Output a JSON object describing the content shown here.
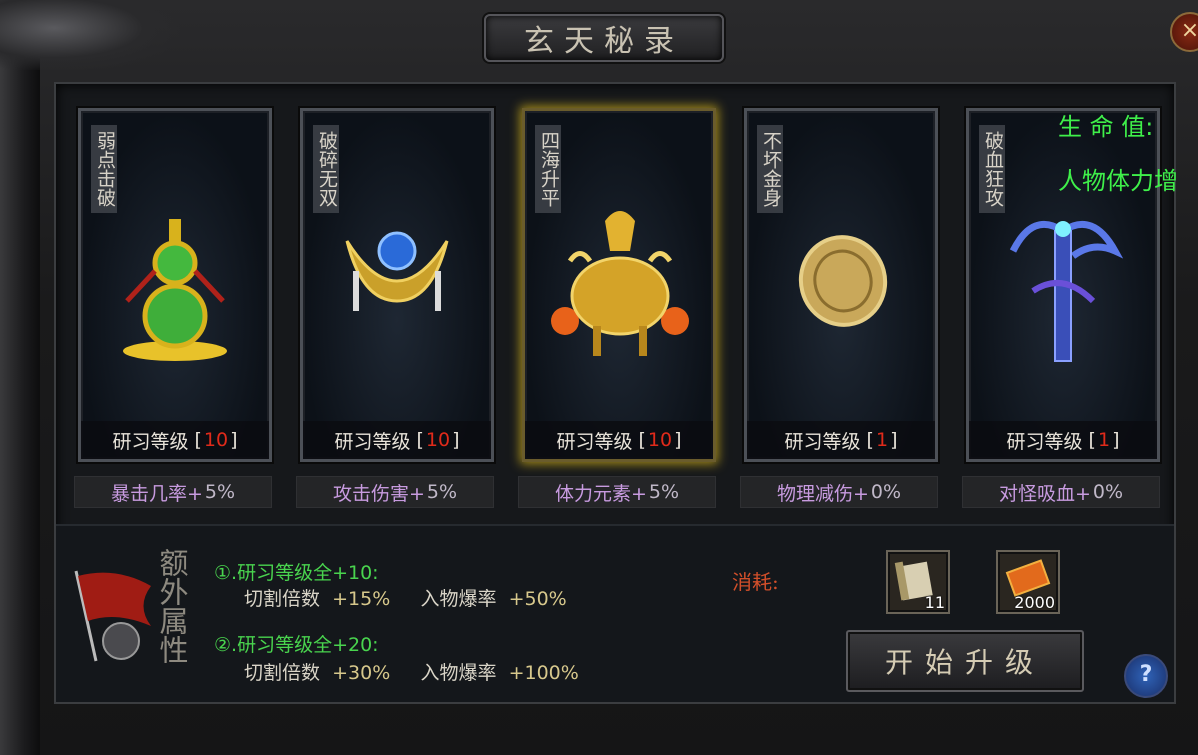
{
  "window": {
    "title": "玄天秘录",
    "close_label": "×"
  },
  "cards": [
    {
      "name": "弱点击破",
      "level_label": "研习等级",
      "level": "10",
      "stat": "暴击几率+",
      "stat_value": "5%"
    },
    {
      "name": "破碎无双",
      "level_label": "研习等级",
      "level": "10",
      "stat": "攻击伤害+",
      "stat_value": "5%"
    },
    {
      "name": "四海升平",
      "level_label": "研习等级",
      "level": "10",
      "stat": "体力元素+",
      "stat_value": "5%",
      "selected": true
    },
    {
      "name": "不坏金身",
      "level_label": "研习等级",
      "level": "1",
      "stat": "物理减伤+",
      "stat_value": "0%"
    },
    {
      "name": "破血狂攻",
      "level_label": "研习等级",
      "level": "1",
      "stat": "对怪吸血+",
      "stat_value": "0%"
    }
  ],
  "extra": {
    "title": "额外属性",
    "bonus1": {
      "title": "①.研习等级全+10:",
      "k1": "切割倍数",
      "v1": "+15%",
      "k2": "入物爆率",
      "v2": "+50%"
    },
    "bonus2": {
      "title": "②.研习等级全+20:",
      "k1": "切割倍数",
      "v1": "+30%",
      "k2": "入物爆率",
      "v2": "+100%"
    }
  },
  "cost": {
    "label": "消耗:",
    "items": [
      {
        "icon": "scroll-icon",
        "count": "11"
      },
      {
        "icon": "token-icon",
        "count": "2000"
      }
    ]
  },
  "upgrade_label": "开始升级",
  "help_label": "?",
  "tooltip": {
    "line1": "生 命 值:",
    "line2": "人物体力增"
  },
  "colors": {
    "level_number": "#e02a1a",
    "bonus_green": "#49d44e",
    "stat_purple": "#c89be0",
    "tooltip_green": "#3ff04a"
  }
}
